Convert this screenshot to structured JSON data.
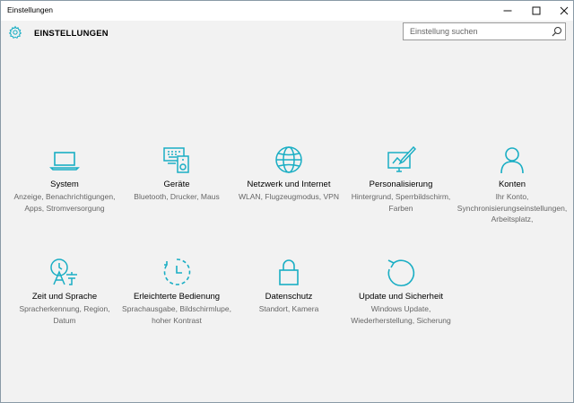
{
  "window": {
    "title": "Einstellungen",
    "controls": [
      "minimize",
      "maximize",
      "close"
    ]
  },
  "header": {
    "heading": "EINSTELLUNGEN",
    "search_placeholder": "Einstellung suchen"
  },
  "colors": {
    "accent": "#1aaec4",
    "background": "#f2f2f2",
    "description_text": "#666666"
  },
  "tiles": [
    {
      "icon": "laptop-icon",
      "label": "System",
      "desc": "Anzeige, Benachrichtigungen, Apps, Stromversorgung"
    },
    {
      "icon": "devices-icon",
      "label": "Geräte",
      "desc": "Bluetooth, Drucker, Maus"
    },
    {
      "icon": "globe-icon",
      "label": "Netzwerk und Internet",
      "desc": "WLAN, Flugzeugmodus, VPN"
    },
    {
      "icon": "personalization-icon",
      "label": "Personalisierung",
      "desc": "Hintergrund, Sperrbildschirm, Farben"
    },
    {
      "icon": "person-icon",
      "label": "Konten",
      "desc": "Ihr Konto, Synchronisierungseinstellungen, Arbeitsplatz,"
    },
    {
      "icon": "time-language-icon",
      "label": "Zeit und Sprache",
      "desc": "Spracherkennung, Region, Datum"
    },
    {
      "icon": "ease-of-access-icon",
      "label": "Erleichterte Bedienung",
      "desc": "Sprachausgabe, Bildschirmlupe, hoher Kontrast"
    },
    {
      "icon": "lock-icon",
      "label": "Datenschutz",
      "desc": "Standort, Kamera"
    },
    {
      "icon": "update-icon",
      "label": "Update und Sicherheit",
      "desc": "Windows Update, Wiederherstellung, Sicherung"
    }
  ]
}
